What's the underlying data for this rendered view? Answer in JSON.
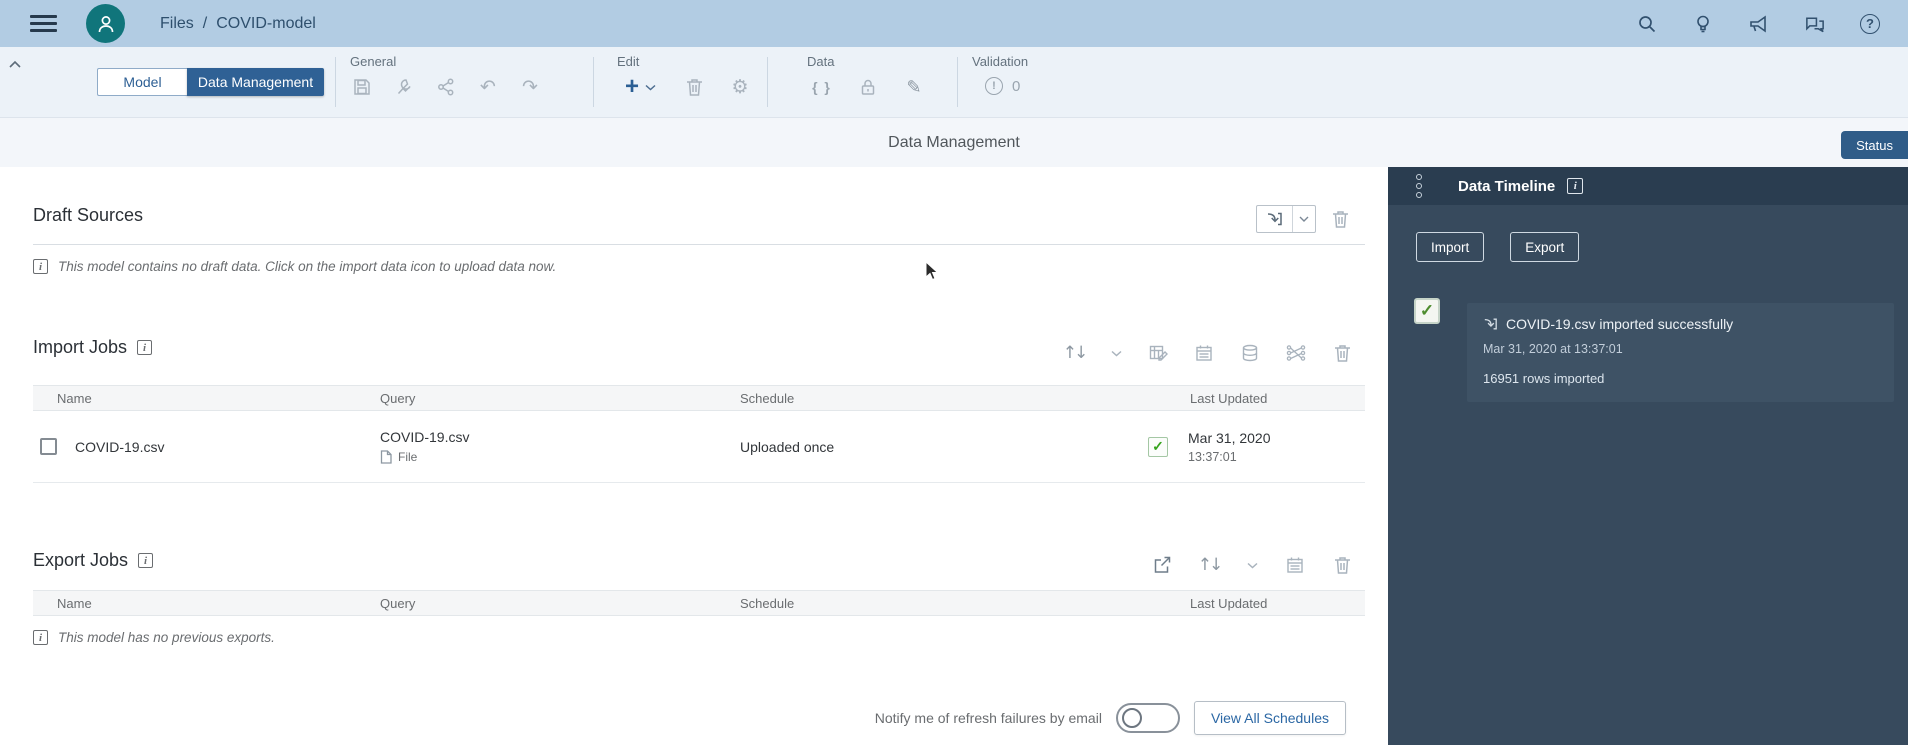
{
  "header": {
    "breadcrumb": {
      "root": "Files",
      "separator": "/",
      "current": "COVID-model"
    }
  },
  "toolbar": {
    "tabs": {
      "model": "Model",
      "data_management": "Data Management"
    },
    "groups": {
      "general": {
        "label": "General"
      },
      "edit": {
        "label": "Edit"
      },
      "data": {
        "label": "Data"
      },
      "validation": {
        "label": "Validation",
        "count": "0"
      }
    }
  },
  "title_bar": {
    "title": "Data Management",
    "status_button": "Status"
  },
  "draft_sources": {
    "heading": "Draft Sources",
    "info_message": "This model contains no draft data. Click on the import data icon to upload data now."
  },
  "import_jobs": {
    "heading": "Import Jobs",
    "columns": [
      "Name",
      "Query",
      "Schedule",
      "Last Updated"
    ],
    "rows": [
      {
        "name": "COVID-19.csv",
        "query": "COVID-19.csv",
        "query_type": "File",
        "schedule": "Uploaded once",
        "updated_date": "Mar 31, 2020",
        "updated_time": "13:37:01"
      }
    ]
  },
  "export_jobs": {
    "heading": "Export Jobs",
    "columns": [
      "Name",
      "Query",
      "Schedule",
      "Last Updated"
    ],
    "info_message": "This model has no previous exports."
  },
  "footer": {
    "notify_label": "Notify me of refresh failures by email",
    "view_all_button": "View All Schedules",
    "toggle_state": "off"
  },
  "timeline": {
    "title": "Data Timeline",
    "import_button": "Import",
    "export_button": "Export",
    "entries": [
      {
        "title": "COVID-19.csv imported successfully",
        "timestamp": "Mar 31, 2020 at 13:37:01",
        "detail": "16951 rows imported"
      }
    ]
  },
  "colors": {
    "header_bg": "#b2cce3",
    "toolbar_bg": "#ecf2f8",
    "accent_blue": "#2f6195",
    "status_button_bg": "#2f5c88",
    "panel_bg": "#374a5d",
    "panel_header_bg": "#2a3d50",
    "card_bg": "#3e5265",
    "success_green": "#36a41d",
    "avatar_teal": "#10757b"
  }
}
